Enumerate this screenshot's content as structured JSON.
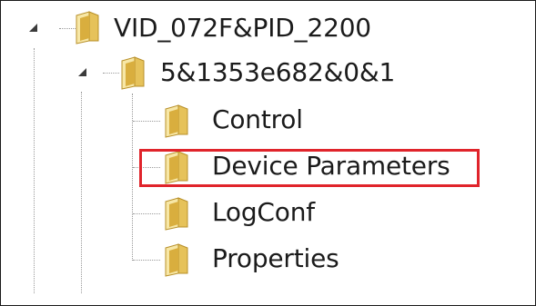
{
  "tree": {
    "root": {
      "label": "VID_072F&PID_2200",
      "expanded": true,
      "children": [
        {
          "label": "5&1353e682&0&1",
          "expanded": true,
          "children": [
            {
              "label": "Control"
            },
            {
              "label": "Device Parameters",
              "highlighted": true
            },
            {
              "label": "LogConf"
            },
            {
              "label": "Properties"
            }
          ]
        }
      ]
    }
  },
  "icons": {
    "expander": "expanded-triangle-icon",
    "folder": "folder-icon"
  },
  "colors": {
    "highlight_border": "#e0242b",
    "folder_body": "#e6c25a",
    "folder_dark": "#b8902a",
    "folder_light": "#f7e7a6",
    "text": "#1b1b1b"
  }
}
